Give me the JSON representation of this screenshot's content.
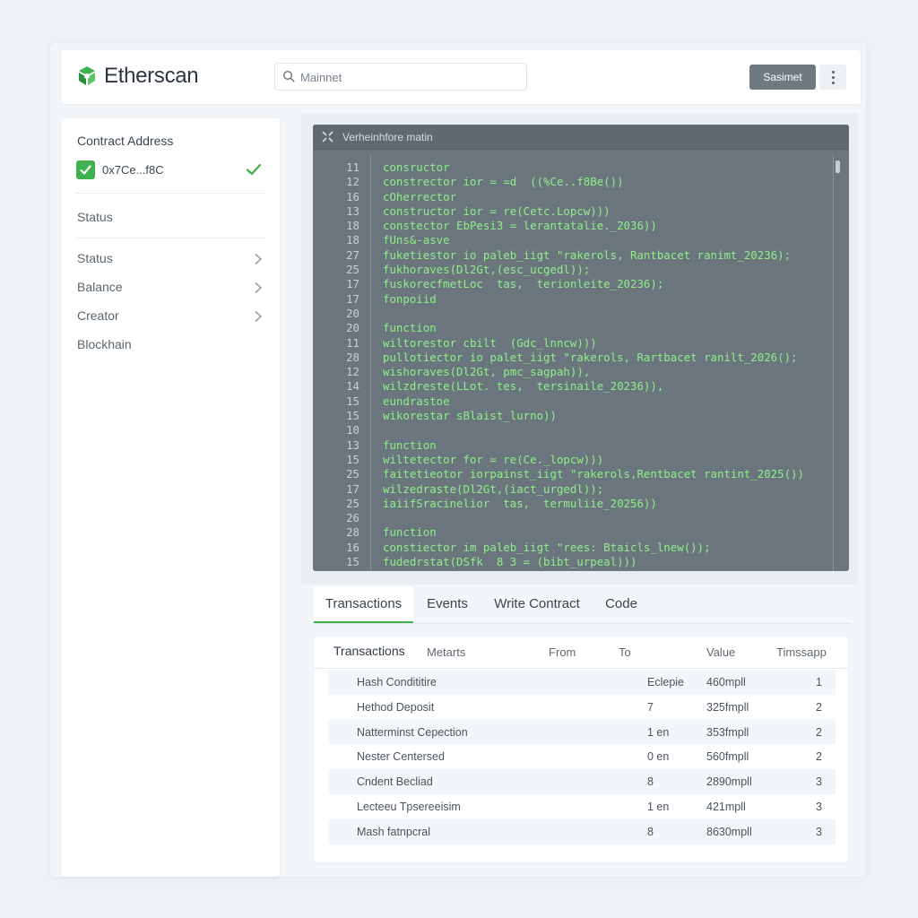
{
  "header": {
    "brand": "Etherscan",
    "search_placeholder": "Mainnet",
    "network_button": "Sasimet",
    "colors": {
      "brand_green": "#3fb24f",
      "button_gray": "#6f7982"
    }
  },
  "sidebar": {
    "heading": "Contract Address",
    "address": "0x7Ce...f8C",
    "status_top": "Status",
    "items": [
      {
        "label": "Status",
        "chevron": true
      },
      {
        "label": "Balance",
        "chevron": true
      },
      {
        "label": "Creator",
        "chevron": true
      },
      {
        "label": "Blockhain",
        "chevron": false
      }
    ]
  },
  "code_panel": {
    "title": "Verheinhfore matin",
    "lines": [
      {
        "num": "11",
        "text": "consructor"
      },
      {
        "num": "12",
        "text": "constrector ior = =d  ((%Ce..f8Be())"
      },
      {
        "num": "16",
        "text": "cOherrector"
      },
      {
        "num": "13",
        "text": "constructor ior = re(Cetc.Lopcw)))"
      },
      {
        "num": "18",
        "text": "constector EbPesi3 = lerantatalie._2036))"
      },
      {
        "num": "18",
        "text": "fUns&-asve"
      },
      {
        "num": "27",
        "text": "fuketiestor io paleb_iigt \"rakerols, Rantbacet ranimt_20236);"
      },
      {
        "num": "25",
        "text": "fukhoraves(Dl2Gt,(esc_ucgedl));"
      },
      {
        "num": "17",
        "text": "fuskorecfmetLoc  tas,  terionleite_20236);"
      },
      {
        "num": "17",
        "text": "fonpoiid"
      },
      {
        "num": "20",
        "text": ""
      },
      {
        "num": "20",
        "text": "function"
      },
      {
        "num": "11",
        "text": "wiltorestor cbilt  (Gdc_lnncw)))"
      },
      {
        "num": "28",
        "text": "pullotiector io palet_iigt \"rakerols, Rartbacet ranilt_2026();"
      },
      {
        "num": "12",
        "text": "wishoraves(Dl2Gt, pmc_sagpah)),"
      },
      {
        "num": "14",
        "text": "wilzdreste(LLot. tes,  tersinaile_20236)),"
      },
      {
        "num": "15",
        "text": "eundrastoe"
      },
      {
        "num": "15",
        "text": "wikorestar sBlaist_lurno))"
      },
      {
        "num": "10",
        "text": ""
      },
      {
        "num": "13",
        "text": "function"
      },
      {
        "num": "15",
        "text": "wiltetector for = re(Ce._lopcw)))"
      },
      {
        "num": "25",
        "text": "faitetieotor iorpainst_iigt \"rakerols,Rentbacet rantint_2025())"
      },
      {
        "num": "17",
        "text": "wilzedraste(Dl2Gt,(iact_urgedl));"
      },
      {
        "num": "25",
        "text": "iaiifSracinelior  tas,  termuliie_20256))"
      },
      {
        "num": "26",
        "text": ""
      },
      {
        "num": "28",
        "text": "function"
      },
      {
        "num": "16",
        "text": "constiector im paleb_iigt \"rees: Btaicls_lnew());"
      },
      {
        "num": "15",
        "text": "fudedrstat(DSfk  8 3 = (bibt_urpeal)))"
      }
    ]
  },
  "tabs": [
    {
      "label": "Transactions",
      "active": true
    },
    {
      "label": "Events",
      "active": false
    },
    {
      "label": "Write Contract",
      "active": false
    },
    {
      "label": "Code",
      "active": false
    }
  ],
  "transactions": {
    "title": "Transactions",
    "columns": {
      "method": "Metarts",
      "from": "From",
      "to": "To",
      "value": "Value",
      "timestamp": "Timssapp"
    },
    "rows": [
      {
        "hash": "Hash Condititire",
        "from": "Eclepie",
        "value": "460mpll",
        "ts": "1"
      },
      {
        "hash": "Hethod Deposit",
        "from": "7",
        "value": "325fmpll",
        "ts": "2"
      },
      {
        "hash": "Natterminst Cepection",
        "from": "1 en",
        "value": "353fmpll",
        "ts": "2"
      },
      {
        "hash": "Nester Centersed",
        "from": "0 en",
        "value": "560fmpll",
        "ts": "2"
      },
      {
        "hash": "Cndent Becliad",
        "from": "8",
        "value": "2890mpll",
        "ts": "3"
      },
      {
        "hash": "Lecteeu Tpsereeisim",
        "from": "1 en",
        "value": "421mpll",
        "ts": "3"
      },
      {
        "hash": "Mash fatnpcral",
        "from": "8",
        "value": "8630mpll",
        "ts": "3"
      }
    ]
  }
}
